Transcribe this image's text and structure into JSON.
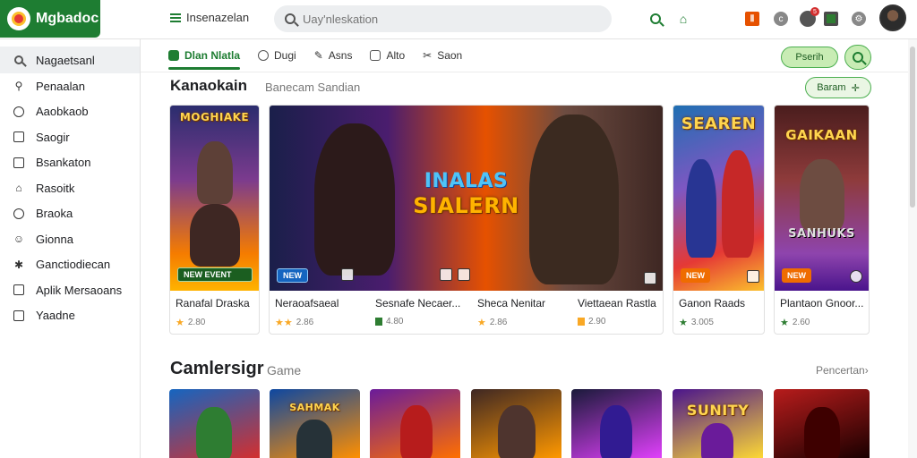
{
  "app": {
    "logo_text": "Mgbadoc"
  },
  "header": {
    "menu_label": "Insenazelan",
    "search_placeholder": "Uay'nleskation",
    "notification_count": "5",
    "icon_names": [
      "search-icon",
      "home-icon",
      "apps-icon",
      "help-icon",
      "notification-icon",
      "grid-icon",
      "settings-icon"
    ]
  },
  "sidebar": {
    "items": [
      {
        "label": "Nagaetsanl",
        "icon": "search-icon"
      },
      {
        "label": "Penaalan",
        "icon": "pin-icon"
      },
      {
        "label": "Aaobkaob",
        "icon": "clock-icon"
      },
      {
        "label": "Saogir",
        "icon": "grid-icon"
      },
      {
        "label": "Bsankaton",
        "icon": "bookmark-icon"
      },
      {
        "label": "Rasoitk",
        "icon": "home-icon"
      },
      {
        "label": "Braoka",
        "icon": "circle-icon"
      },
      {
        "label": "Gionna",
        "icon": "people-icon"
      },
      {
        "label": "Ganctiodiecan",
        "icon": "puzzle-icon"
      },
      {
        "label": "Aplik Mersaoans",
        "icon": "doc-icon"
      },
      {
        "label": "Yaadne",
        "icon": "list-icon"
      }
    ]
  },
  "tabs": [
    {
      "label": "Dlan Nlatla",
      "active": true
    },
    {
      "label": "Dugi",
      "active": false
    },
    {
      "label": "Asns",
      "active": false
    },
    {
      "label": "Alto",
      "active": false
    },
    {
      "label": "Saon",
      "active": false
    }
  ],
  "action_pill": "Pserih",
  "section1": {
    "title": "Kanaokain",
    "subtitle": "Banecam Sandian",
    "see_more": "Baram",
    "cards": [
      {
        "art_title": "MOGHIAKE",
        "name": "Ranafal Draska",
        "rating": "2.80",
        "tag": "NEW EVENT",
        "color_a": "#2b2d6e",
        "color_b": "#f57c00"
      },
      {
        "art_title": "SIALERN",
        "art_kicker": "INALAS",
        "name": "Neraoafsaeal",
        "rating": "2.86",
        "tag": "NEW",
        "color_a": "#1a1f4a",
        "color_b": "#e65100"
      },
      {
        "name": "Sesnafe Necaer...",
        "rating": "4.80",
        "tag": "",
        "color_a": "#3a2a20",
        "color_b": "#c77b3a"
      },
      {
        "name": "Sheca Nenitar",
        "rating": "2.86",
        "tag": "",
        "color_a": "#5a2d1a",
        "color_b": "#ffb74d"
      },
      {
        "name": "Viettaean Rastla",
        "rating": "2.90",
        "tag": "",
        "color_a": "#3c2a1e",
        "color_b": "#e08a3a"
      },
      {
        "art_title": "SEAREN",
        "name": "Ganon Raads",
        "rating": "3.005",
        "tag": "NEW",
        "color_a": "#1f6fb2",
        "color_b": "#e53935"
      },
      {
        "art_title": "GAIKAAN",
        "art_kicker": "SANHUKS",
        "name": "Plantaon  Gnoor...",
        "rating": "2.60",
        "tag": "NEW",
        "color_a": "#4a1d1d",
        "color_b": "#8e44ad"
      }
    ]
  },
  "section2": {
    "title": "Camlersigr",
    "subtitle": "Game",
    "more_link": "Pencertan",
    "thumbs": [
      {
        "art_title": "",
        "color_a": "#1565c0",
        "color_b": "#d32f2f"
      },
      {
        "art_title": "SAHMAK",
        "color_a": "#0d47a1",
        "color_b": "#ff8f00"
      },
      {
        "art_title": "",
        "color_a": "#6a1b9a",
        "color_b": "#ff6f00"
      },
      {
        "art_title": "",
        "color_a": "#3e2723",
        "color_b": "#ff9800"
      },
      {
        "art_title": "",
        "color_a": "#1a1a3a",
        "color_b": "#e040fb"
      },
      {
        "art_title": "SUNITY",
        "color_a": "#4a148c",
        "color_b": "#fdd835"
      },
      {
        "art_title": "",
        "color_a": "#b71c1c",
        "color_b": "#1a0000"
      }
    ]
  },
  "colors": {
    "brand_green": "#1e7d32",
    "accent_light_green": "#c8ecb4",
    "star_yellow": "#f9a825"
  }
}
